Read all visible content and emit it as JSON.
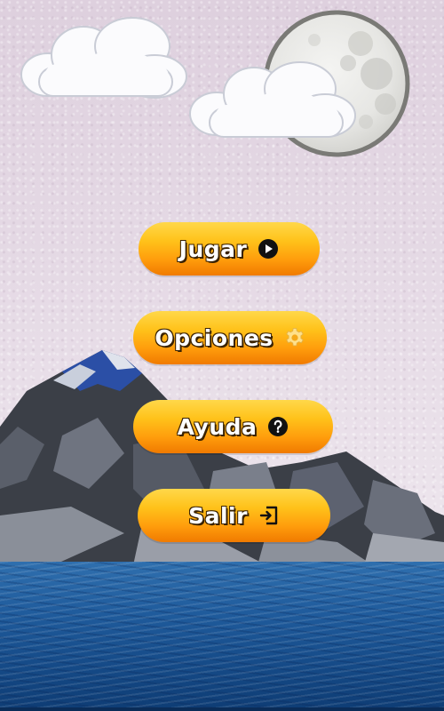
{
  "menu": {
    "items": [
      {
        "label": "Jugar",
        "icon": "play-icon"
      },
      {
        "label": "Opciones",
        "icon": "gear-icon"
      },
      {
        "label": "Ayuda",
        "icon": "help-icon"
      },
      {
        "label": "Salir",
        "icon": "exit-icon"
      }
    ]
  },
  "colors": {
    "button_top": "#ffd84a",
    "button_bottom": "#f07a00",
    "sky": "#e3d6e3",
    "sea": "#1f5b9c"
  }
}
